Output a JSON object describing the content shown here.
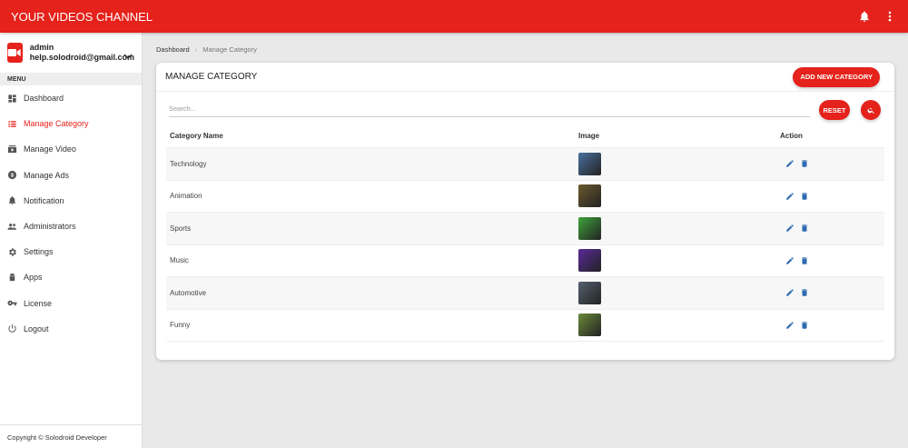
{
  "app": {
    "title": "YOUR VIDEOS CHANNEL"
  },
  "topbar": {
    "icons": [
      "notification-bell-icon",
      "more-vert-icon"
    ]
  },
  "user": {
    "name": "admin",
    "email": "help.solodroid@gmail.com"
  },
  "sidebar": {
    "menu_header": "MENU",
    "items": [
      {
        "label": "Dashboard",
        "icon": "dashboard-icon"
      },
      {
        "label": "Manage Category",
        "icon": "list-icon",
        "active": true
      },
      {
        "label": "Manage Video",
        "icon": "video-library-icon"
      },
      {
        "label": "Manage Ads",
        "icon": "monetization-icon"
      },
      {
        "label": "Notification",
        "icon": "bell-icon"
      },
      {
        "label": "Administrators",
        "icon": "people-icon"
      },
      {
        "label": "Settings",
        "icon": "settings-icon"
      },
      {
        "label": "Apps",
        "icon": "android-icon"
      },
      {
        "label": "License",
        "icon": "key-icon"
      },
      {
        "label": "Logout",
        "icon": "power-icon"
      }
    ],
    "footer": "Copyright © Solodroid Developer"
  },
  "breadcrumb": {
    "items": [
      "Dashboard",
      "Manage Category"
    ]
  },
  "card": {
    "title": "MANAGE CATEGORY",
    "add_button": "ADD NEW CATEGORY",
    "search_placeholder": "Search...",
    "reset_button": "RESET"
  },
  "table": {
    "headers": {
      "name": "Category Name",
      "image": "Image",
      "action": "Action"
    },
    "rows": [
      {
        "name": "Technology",
        "thumb_color": "#4a6fa0"
      },
      {
        "name": "Animation",
        "thumb_color": "#6b5a2e"
      },
      {
        "name": "Sports",
        "thumb_color": "#3fa33a"
      },
      {
        "name": "Music",
        "thumb_color": "#5a2a9a"
      },
      {
        "name": "Automotive",
        "thumb_color": "#556070"
      },
      {
        "name": "Funny",
        "thumb_color": "#6a8a3a"
      }
    ]
  },
  "colors": {
    "primary": "#e5221b",
    "action_icon": "#2f6ab0"
  }
}
